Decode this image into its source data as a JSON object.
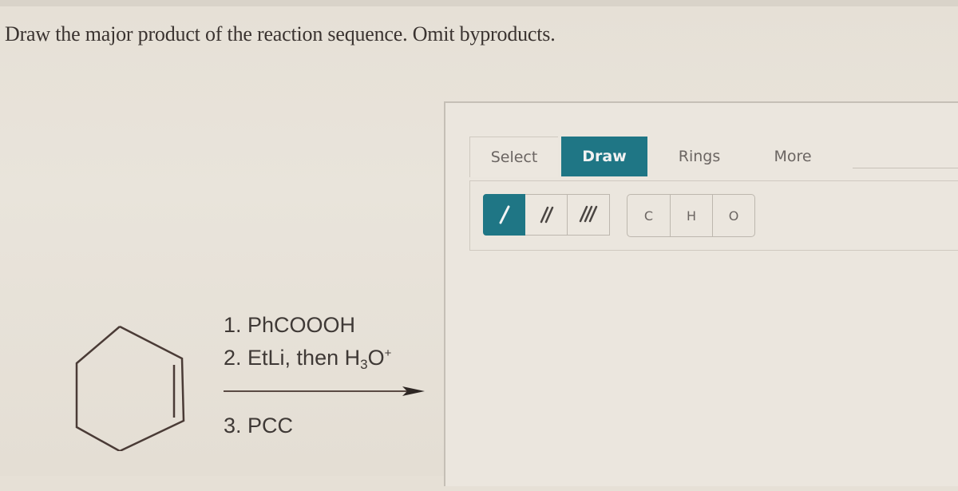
{
  "question": {
    "text": "Draw the major product of the reaction sequence. Omit byproducts."
  },
  "reaction": {
    "starting_material": "cyclohexene",
    "steps": {
      "step1": "1. PhCOOOH",
      "step2_prefix": "2. EtLi, then H",
      "step2_sub": "3",
      "step2_mid": "O",
      "step2_sup": "+",
      "step3": "3. PCC"
    }
  },
  "editor": {
    "tabs": [
      {
        "label": "Select",
        "active": false
      },
      {
        "label": "Draw",
        "active": true
      },
      {
        "label": "Rings",
        "active": false
      },
      {
        "label": "More",
        "active": false
      }
    ],
    "bond_tools": [
      {
        "name": "single-bond",
        "active": true
      },
      {
        "name": "double-bond",
        "active": false
      },
      {
        "name": "triple-bond",
        "active": false
      }
    ],
    "atom_tools": [
      {
        "label": "C"
      },
      {
        "label": "H"
      },
      {
        "label": "O"
      }
    ],
    "accent_color": "#1f7685"
  }
}
